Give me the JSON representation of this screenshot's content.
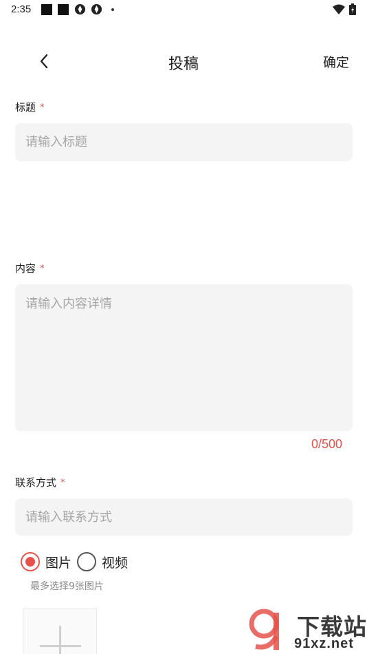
{
  "status_bar": {
    "time": "2:35",
    "icons": [
      "notification-square-icon",
      "notification-square-icon",
      "aperture-icon",
      "aperture-icon",
      "dot-icon",
      "wifi-icon",
      "battery-icon"
    ]
  },
  "app_bar": {
    "title": "投稿",
    "confirm_label": "确定",
    "back_icon": "chevron-left-icon"
  },
  "form": {
    "title_field": {
      "label": "标题",
      "required_mark": "*",
      "placeholder": "请输入标题",
      "value": ""
    },
    "content_field": {
      "label": "内容",
      "required_mark": "*",
      "placeholder": "请输入内容详情",
      "value": "",
      "char_count": "0/500"
    },
    "contact_field": {
      "label": "联系方式",
      "required_mark": "*",
      "placeholder": "请输入联系方式",
      "value": ""
    },
    "media_type": {
      "options": [
        {
          "label": "图片",
          "selected": true
        },
        {
          "label": "视频",
          "selected": false
        }
      ],
      "hint": "最多选择9张图片"
    },
    "upload_icon": "plus-icon"
  },
  "watermark": {
    "logo_text": "下载站",
    "site": "91xz.net"
  },
  "colors": {
    "accent": "#e5534b",
    "input_background": "#f4f4f4",
    "placeholder": "#a6a6a6"
  }
}
